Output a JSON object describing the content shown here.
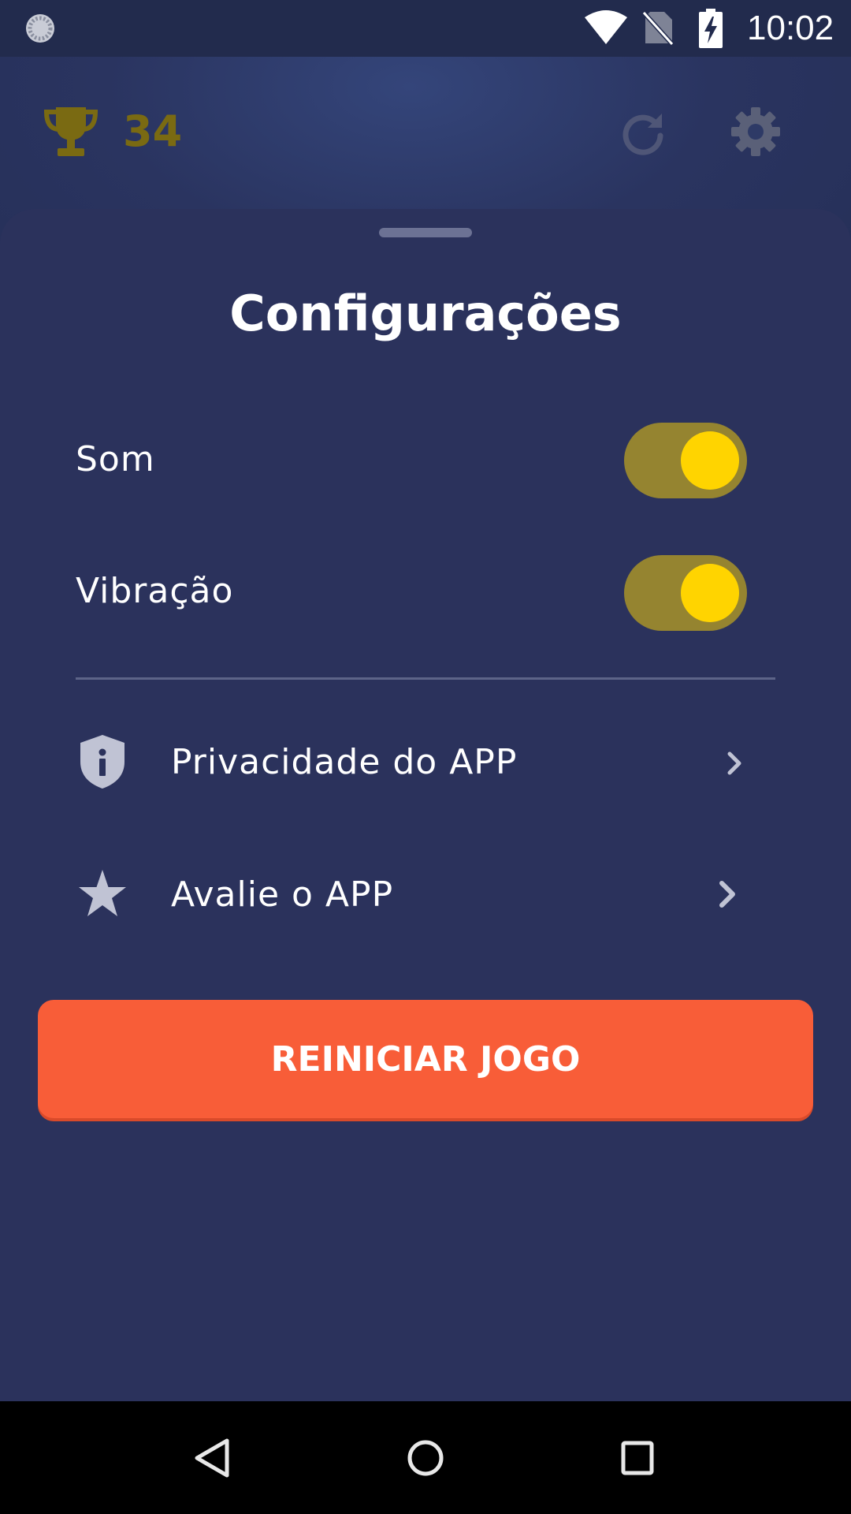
{
  "status_bar": {
    "time": "10:02",
    "icons": [
      "loading-icon",
      "wifi-icon",
      "no-sim-icon",
      "battery-charging-icon"
    ]
  },
  "header": {
    "score": "34",
    "score_color": "#7a6a12",
    "icons": [
      "trophy-icon",
      "restart-icon",
      "gear-icon"
    ]
  },
  "settings_sheet": {
    "title": "Configurações",
    "toggles": [
      {
        "label": "Som",
        "on": true
      },
      {
        "label": "Vibração",
        "on": true
      }
    ],
    "menu_items": [
      {
        "label": "Privacidade do APP",
        "icon": "shield-info-icon"
      },
      {
        "label": "Avalie o APP",
        "icon": "star-icon"
      }
    ],
    "restart_button_label": "REINICIAR JOGO"
  },
  "colors": {
    "background": "#2b325c",
    "toggle_track": "#958430",
    "toggle_knob": "#ffd400",
    "button": "#f85d38"
  },
  "nav_bar": {
    "buttons": [
      "back-icon",
      "home-icon",
      "recents-icon"
    ]
  }
}
